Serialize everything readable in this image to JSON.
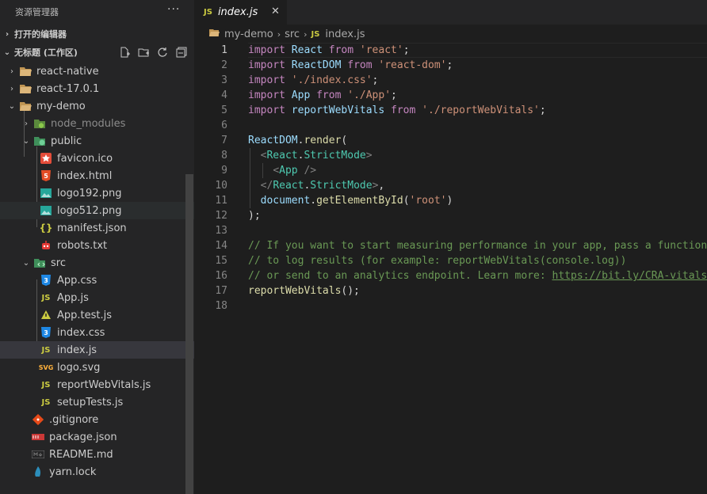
{
  "explorer": {
    "title": "资源管理器",
    "more": "···",
    "open_editors": "打开的编辑器",
    "workspace": "无标题 (工作区)"
  },
  "tree": [
    {
      "label": "react-native",
      "kind": "folder",
      "depth": 1,
      "chev": "›",
      "icon": "folder-icon"
    },
    {
      "label": "react-17.0.1",
      "kind": "folder",
      "depth": 1,
      "chev": "›",
      "icon": "folder-icon"
    },
    {
      "label": "my-demo",
      "kind": "folder",
      "depth": 1,
      "chev": "⌄",
      "icon": "folder-open-icon"
    },
    {
      "label": "node_modules",
      "kind": "folder",
      "depth": 2,
      "chev": "›",
      "icon": "node-folder-icon",
      "dim": true
    },
    {
      "label": "public",
      "kind": "folder",
      "depth": 2,
      "chev": "⌄",
      "icon": "public-folder-icon"
    },
    {
      "label": "favicon.ico",
      "kind": "file",
      "depth": 3,
      "icon": "favicon-icon"
    },
    {
      "label": "index.html",
      "kind": "file",
      "depth": 3,
      "icon": "html-icon"
    },
    {
      "label": "logo192.png",
      "kind": "file",
      "depth": 3,
      "icon": "image-icon"
    },
    {
      "label": "logo512.png",
      "kind": "file",
      "depth": 3,
      "icon": "image-icon",
      "hover": true
    },
    {
      "label": "manifest.json",
      "kind": "file",
      "depth": 3,
      "icon": "json-icon"
    },
    {
      "label": "robots.txt",
      "kind": "file",
      "depth": 3,
      "icon": "robot-icon"
    },
    {
      "label": "src",
      "kind": "folder",
      "depth": 2,
      "chev": "⌄",
      "icon": "src-folder-icon"
    },
    {
      "label": "App.css",
      "kind": "file",
      "depth": 3,
      "icon": "css-icon"
    },
    {
      "label": "App.js",
      "kind": "file",
      "depth": 3,
      "icon": "js-icon"
    },
    {
      "label": "App.test.js",
      "kind": "file",
      "depth": 3,
      "icon": "test-js-icon"
    },
    {
      "label": "index.css",
      "kind": "file",
      "depth": 3,
      "icon": "css-icon"
    },
    {
      "label": "index.js",
      "kind": "file",
      "depth": 3,
      "icon": "js-icon",
      "selected": true
    },
    {
      "label": "logo.svg",
      "kind": "file",
      "depth": 3,
      "icon": "svg-icon"
    },
    {
      "label": "reportWebVitals.js",
      "kind": "file",
      "depth": 3,
      "icon": "js-icon"
    },
    {
      "label": "setupTests.js",
      "kind": "file",
      "depth": 3,
      "icon": "js-icon"
    },
    {
      "label": ".gitignore",
      "kind": "file",
      "depth": 2,
      "icon": "git-icon"
    },
    {
      "label": "package.json",
      "kind": "file",
      "depth": 2,
      "icon": "npm-icon"
    },
    {
      "label": "README.md",
      "kind": "file",
      "depth": 2,
      "icon": "markdown-icon"
    },
    {
      "label": "yarn.lock",
      "kind": "file",
      "depth": 2,
      "icon": "yarn-icon"
    }
  ],
  "tab": {
    "lang": "JS",
    "name": "index.js",
    "close": "✕"
  },
  "breadcrumb": {
    "folder": "my-demo",
    "sub": "src",
    "lang": "JS",
    "file": "index.js"
  },
  "code": [
    [
      [
        "kw",
        "import "
      ],
      [
        "id",
        "React "
      ],
      [
        "kw",
        "from "
      ],
      [
        "str",
        "'react'"
      ],
      [
        "pun",
        ";"
      ]
    ],
    [
      [
        "kw",
        "import "
      ],
      [
        "id",
        "ReactDOM "
      ],
      [
        "kw",
        "from "
      ],
      [
        "str",
        "'react-dom'"
      ],
      [
        "pun",
        ";"
      ]
    ],
    [
      [
        "kw",
        "import "
      ],
      [
        "str",
        "'./index.css'"
      ],
      [
        "pun",
        ";"
      ]
    ],
    [
      [
        "kw",
        "import "
      ],
      [
        "id",
        "App "
      ],
      [
        "kw",
        "from "
      ],
      [
        "str",
        "'./App'"
      ],
      [
        "pun",
        ";"
      ]
    ],
    [
      [
        "kw",
        "import "
      ],
      [
        "id",
        "reportWebVitals "
      ],
      [
        "kw",
        "from "
      ],
      [
        "str",
        "'./reportWebVitals'"
      ],
      [
        "pun",
        ";"
      ]
    ],
    [],
    [
      [
        "id",
        "ReactDOM"
      ],
      [
        "pun",
        "."
      ],
      [
        "fn",
        "render"
      ],
      [
        "pun",
        "("
      ]
    ],
    [
      [
        "pun",
        "  "
      ],
      [
        "br",
        "<"
      ],
      [
        "cls",
        "React"
      ],
      [
        "pun",
        "."
      ],
      [
        "cls",
        "StrictMode"
      ],
      [
        "br",
        ">"
      ]
    ],
    [
      [
        "pun",
        "    "
      ],
      [
        "br",
        "<"
      ],
      [
        "cls",
        "App"
      ],
      [
        "pun",
        " "
      ],
      [
        "br",
        "/>"
      ]
    ],
    [
      [
        "pun",
        "  "
      ],
      [
        "br",
        "</"
      ],
      [
        "cls",
        "React"
      ],
      [
        "pun",
        "."
      ],
      [
        "cls",
        "StrictMode"
      ],
      [
        "br",
        ">"
      ],
      [
        "pun",
        ","
      ]
    ],
    [
      [
        "pun",
        "  "
      ],
      [
        "id",
        "document"
      ],
      [
        "pun",
        "."
      ],
      [
        "fn",
        "getElementById"
      ],
      [
        "pun",
        "("
      ],
      [
        "str",
        "'root'"
      ],
      [
        "pun",
        ")"
      ]
    ],
    [
      [
        "pun",
        ");"
      ]
    ],
    [],
    [
      [
        "cm",
        "// If you want to start measuring performance in your app, pass a function"
      ]
    ],
    [
      [
        "cm",
        "// to log results (for example: reportWebVitals(console.log))"
      ]
    ],
    [
      [
        "cm",
        "// or send to an analytics endpoint. Learn more: "
      ],
      [
        "url",
        "https://bit.ly/CRA-vitals"
      ]
    ],
    [
      [
        "fn",
        "reportWebVitals"
      ],
      [
        "pun",
        "();"
      ]
    ],
    []
  ],
  "colors": {
    "sidebar": "#252526",
    "editor": "#1e1e1e",
    "selected": "#37373d"
  }
}
